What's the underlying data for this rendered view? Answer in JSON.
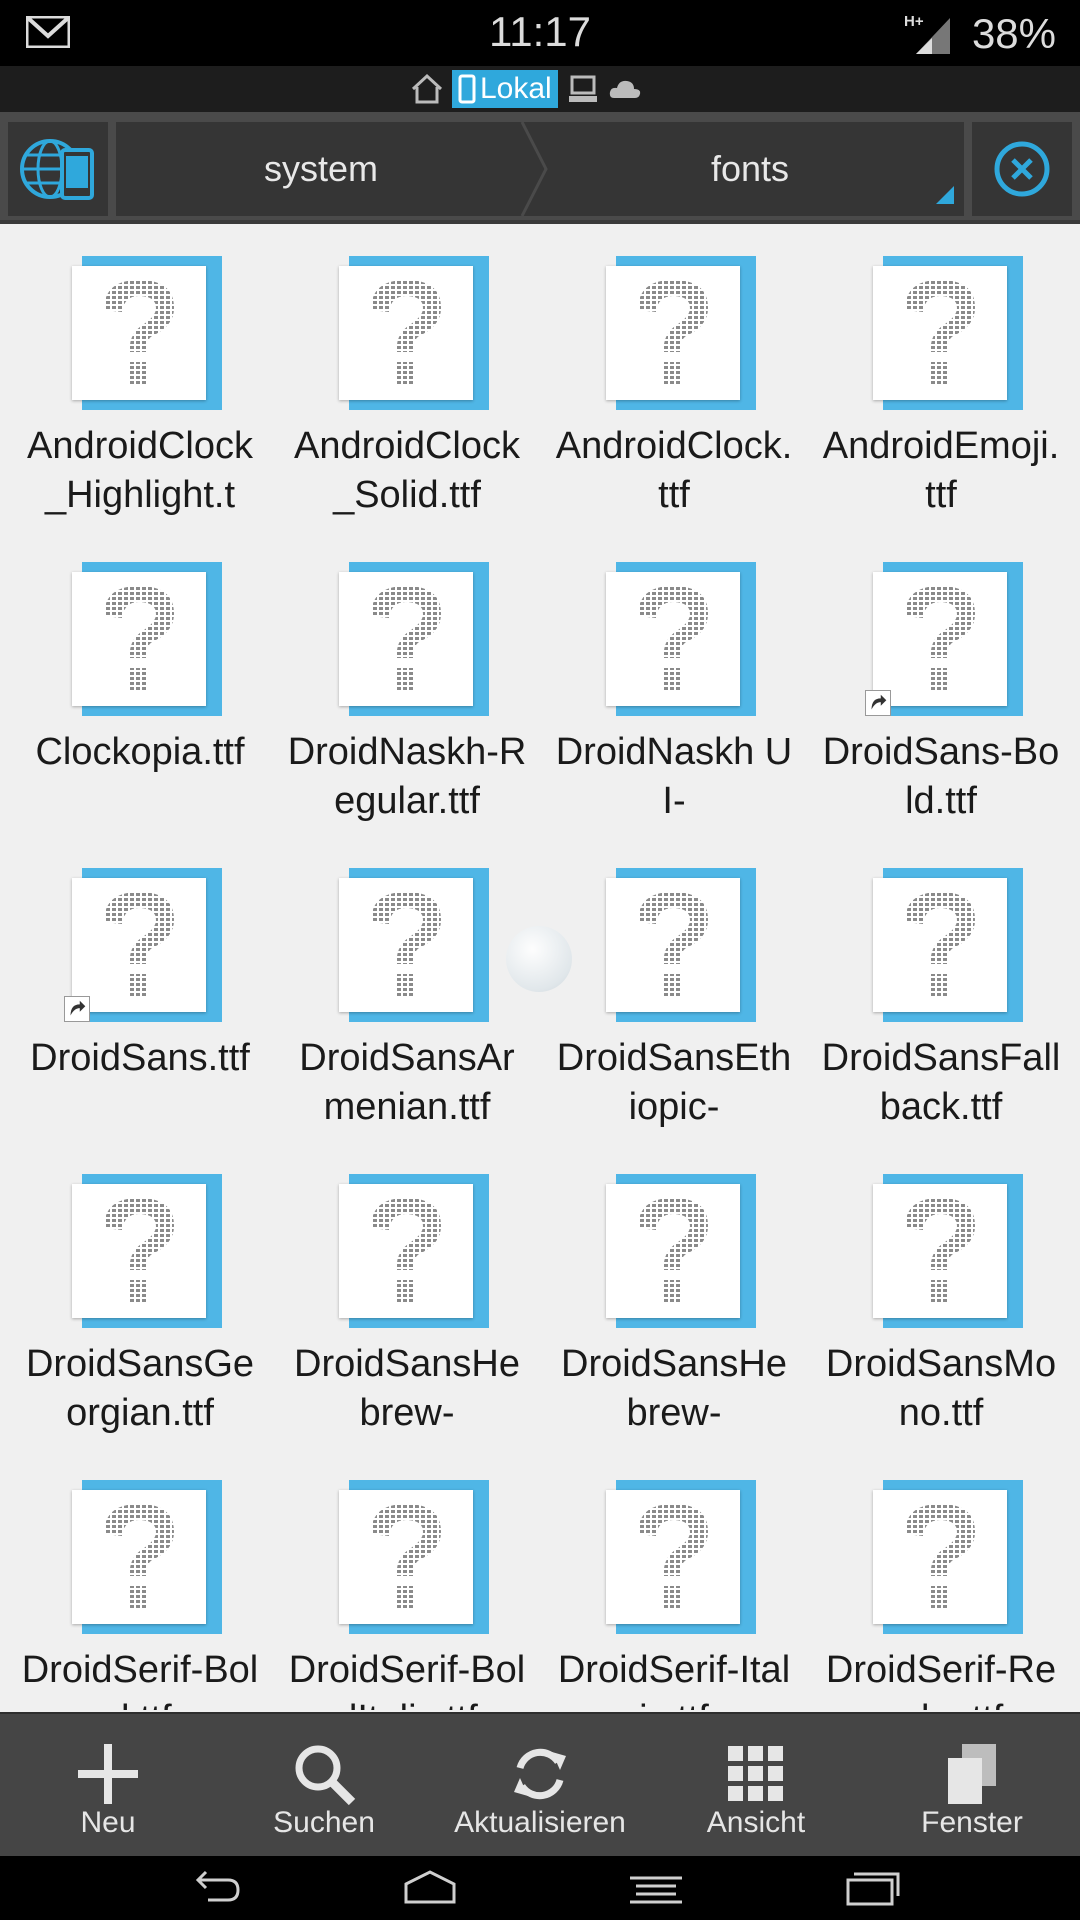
{
  "status": {
    "time": "11:17",
    "network": "H+",
    "battery": "38%"
  },
  "location": {
    "active_label": "Lokal"
  },
  "path": {
    "crumbs": [
      "system",
      "fonts"
    ]
  },
  "files": [
    {
      "name": "AndroidClock_Highlight.t",
      "link": false
    },
    {
      "name": "AndroidClock_Solid.ttf",
      "link": false
    },
    {
      "name": "AndroidClock.ttf",
      "link": false
    },
    {
      "name": "AndroidEmoji.ttf",
      "link": false
    },
    {
      "name": "Clockopia.ttf",
      "link": false
    },
    {
      "name": "DroidNaskh-Regular.ttf",
      "link": false
    },
    {
      "name": "DroidNaskh UI-",
      "link": false
    },
    {
      "name": "DroidSans-Bold.ttf",
      "link": true
    },
    {
      "name": "DroidSans.ttf",
      "link": true
    },
    {
      "name": "DroidSansArmenian.ttf",
      "link": false
    },
    {
      "name": "DroidSansEthiopic-",
      "link": false
    },
    {
      "name": "DroidSansFallback.ttf",
      "link": false
    },
    {
      "name": "DroidSansGeorgian.ttf",
      "link": false
    },
    {
      "name": "DroidSansHebrew-",
      "link": false
    },
    {
      "name": "DroidSansHebrew-",
      "link": false
    },
    {
      "name": "DroidSansMono.ttf",
      "link": false
    },
    {
      "name": "DroidSerif-Bold.ttf",
      "link": false
    },
    {
      "name": "DroidSerif-BoldItalic.ttf",
      "link": false
    },
    {
      "name": "DroidSerif-Italic.ttf",
      "link": false
    },
    {
      "name": "DroidSerif-Regular.ttf",
      "link": false
    }
  ],
  "toolbar": {
    "items": [
      {
        "label": "Neu",
        "icon": "plus-icon"
      },
      {
        "label": "Suchen",
        "icon": "search-icon"
      },
      {
        "label": "Aktualisieren",
        "icon": "refresh-icon"
      },
      {
        "label": "Ansicht",
        "icon": "grid-view-icon"
      },
      {
        "label": "Fenster",
        "icon": "windows-icon"
      }
    ]
  },
  "colors": {
    "accent": "#2fa8dc",
    "file_back": "#4fb6e6",
    "toolbar_bg": "#454545"
  }
}
